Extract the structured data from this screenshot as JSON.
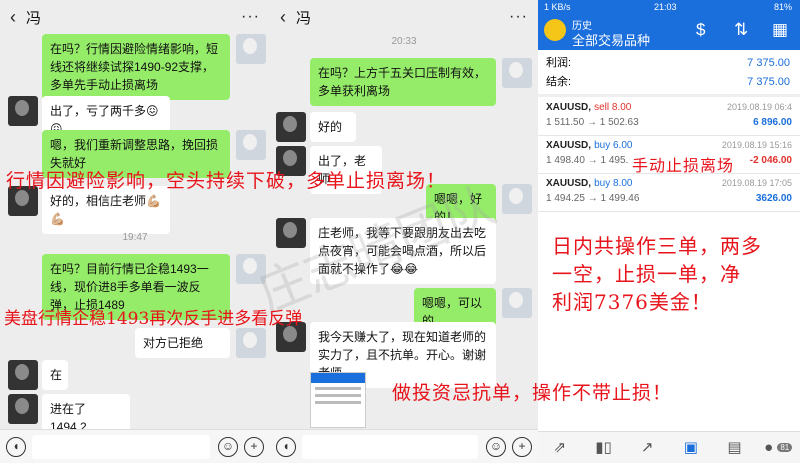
{
  "panel1": {
    "title": "冯",
    "messages": [
      "在吗？行情因避险情绪影响，短线还将继续试探1490-92支撑，多单先手动止损离场",
      "出了，亏了两千多😖😖",
      "嗯，我们重新调整思路，挽回损失就好",
      "好的，相信庄老师💪🏼💪🏼",
      "在吗？目前行情已企稳1493一线，现价进8手多单看一波反弹，止损1489",
      "对方已拒绝",
      "在",
      "进在了1494.2"
    ],
    "time": "19:47"
  },
  "panel2": {
    "title": "冯",
    "time": "20:33",
    "messages": [
      "在吗？上方千五关口压制有效，多单获利离场",
      "好的",
      "出了，老师",
      "嗯嗯，好的！",
      "庄老师，我等下要跟朋友出去吃点夜宵，可能会喝点酒，所以后面就不操作了😂😂",
      "嗯嗯，可以的",
      "我今天赚大了，现在知道老师的实力了，且不抗单。开心。谢谢老师"
    ]
  },
  "panel3": {
    "status_left": "1 KB/s",
    "status_time": "21:03",
    "status_right": "81%",
    "header_sub": "历史",
    "header_title": "全部交易品种",
    "profit_label": "利润:",
    "profit_value": "7 375.00",
    "balance_label": "结余:",
    "balance_value": "7 375.00",
    "trades": [
      {
        "symbol": "XAUUSD,",
        "side": "sell 8.00",
        "date": "2019.08.19 06:4",
        "prices": "1 511.50 → 1 502.63",
        "pl": "6 896.00"
      },
      {
        "symbol": "XAUUSD,",
        "side": "buy 6.00",
        "date": "2019.08.19 15:16",
        "prices": "1 498.40 → 1 495.",
        "pl": "-2 046.00"
      },
      {
        "symbol": "XAUUSD,",
        "side": "buy 8.00",
        "date": "2019.08.19 17:05",
        "prices": "1 494.25 → 1 499.46",
        "pl": "3626.00"
      }
    ],
    "badge": "81"
  },
  "overlays": {
    "a": "行情因避险影响，空头持续下破，多单止损离场！",
    "b": "手动止损离场",
    "c1": "日内共操作三单，两多",
    "c2": "一空，止损一单，净",
    "c3": "利润7376美金！",
    "d": "美盘行情企稳1493再次反手进多看反弹",
    "e": "做投资忌抗单，操作不带止损！",
    "watermark": "庄志晴团队"
  },
  "colors": {
    "wechat_green": "#95ec69",
    "overlay_red": "#e8141b",
    "mt_blue": "#1a6fdc"
  }
}
